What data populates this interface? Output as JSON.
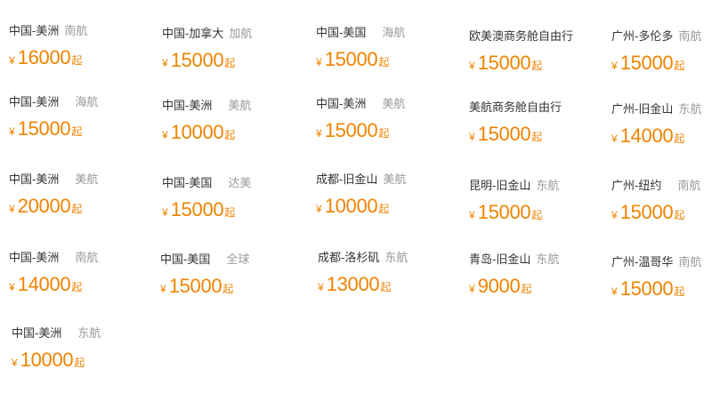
{
  "deals": [
    {
      "route": "中国-美洲",
      "airline": "南航",
      "currency": "¥",
      "price": "16000",
      "suffix": "起"
    },
    {
      "route": "中国-加拿大",
      "airline": "加航",
      "currency": "¥",
      "price": "15000",
      "suffix": "起"
    },
    {
      "route": "中国-美国",
      "airline": "海航",
      "currency": "¥",
      "price": "15000",
      "suffix": "起"
    },
    {
      "route": "欧美澳商务舱自由行",
      "airline": "",
      "currency": "¥",
      "price": "15000",
      "suffix": "起"
    },
    {
      "route": "广州-多伦多",
      "airline": "南航",
      "currency": "¥",
      "price": "15000",
      "suffix": "起"
    },
    {
      "route": "中国-美洲",
      "airline": "海航",
      "currency": "¥",
      "price": "15000",
      "suffix": "起"
    },
    {
      "route": "中国-美洲",
      "airline": "美航",
      "currency": "¥",
      "price": "10000",
      "suffix": "起"
    },
    {
      "route": "中国-美洲",
      "airline": "美航",
      "currency": "¥",
      "price": "15000",
      "suffix": "起"
    },
    {
      "route": "美航商务舱自由行",
      "airline": "",
      "currency": "¥",
      "price": "15000",
      "suffix": "起"
    },
    {
      "route": "广州-旧金山",
      "airline": "东航",
      "currency": "¥",
      "price": "14000",
      "suffix": "起"
    },
    {
      "route": "中国-美洲",
      "airline": "美航",
      "currency": "¥",
      "price": "20000",
      "suffix": "起"
    },
    {
      "route": "中国-美国",
      "airline": "达美",
      "currency": "¥",
      "price": "15000",
      "suffix": "起"
    },
    {
      "route": "成都-旧金山",
      "airline": "美航",
      "currency": "¥",
      "price": "10000",
      "suffix": "起"
    },
    {
      "route": "昆明-旧金山",
      "airline": "东航",
      "currency": "¥",
      "price": "15000",
      "suffix": "起"
    },
    {
      "route": "广州-纽约",
      "airline": "南航",
      "currency": "¥",
      "price": "15000",
      "suffix": "起"
    },
    {
      "route": "中国-美洲",
      "airline": "南航",
      "currency": "¥",
      "price": "14000",
      "suffix": "起"
    },
    {
      "route": "中国-美国",
      "airline": "全球",
      "currency": "¥",
      "price": "15000",
      "suffix": "起"
    },
    {
      "route": "成都-洛杉矶",
      "airline": "东航",
      "currency": "¥",
      "price": "13000",
      "suffix": "起"
    },
    {
      "route": "青岛-旧金山",
      "airline": "东航",
      "currency": "¥",
      "price": "9000",
      "suffix": "起"
    },
    {
      "route": "广州-温哥华",
      "airline": "南航",
      "currency": "¥",
      "price": "15000",
      "suffix": "起"
    },
    {
      "route": "中国-美洲",
      "airline": "东航",
      "currency": "¥",
      "price": "10000",
      "suffix": "起"
    }
  ],
  "colors": {
    "price": "#f08300",
    "route": "#333333",
    "airline": "#999999"
  }
}
